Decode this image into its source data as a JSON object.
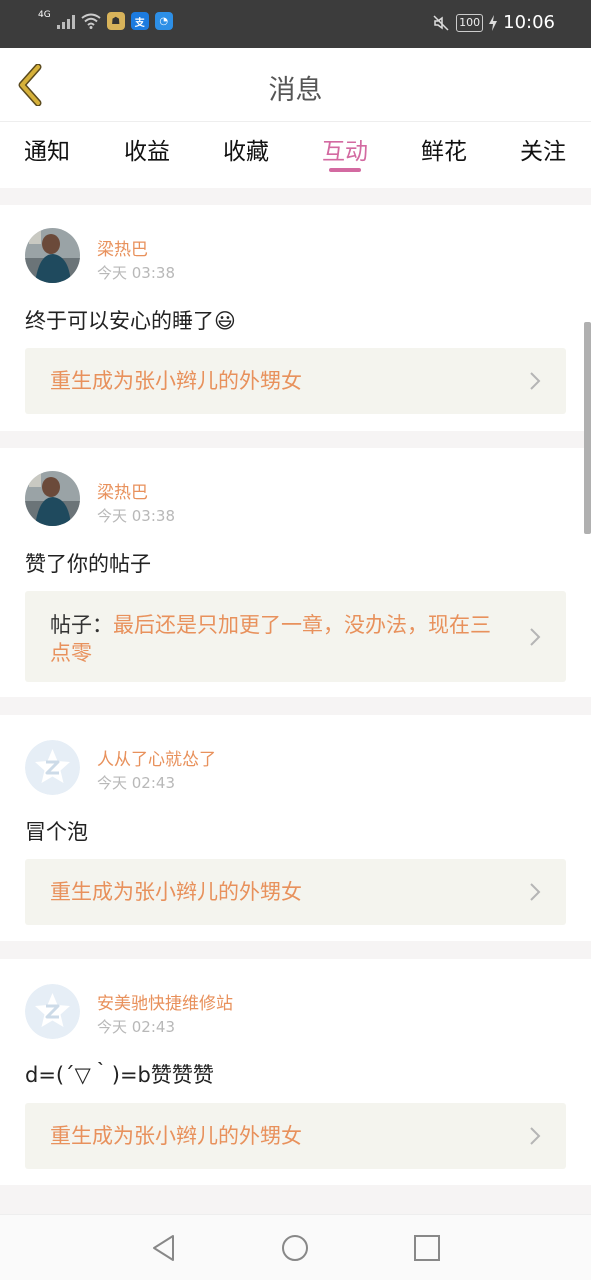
{
  "status_bar": {
    "network": "4G",
    "time": "10:06",
    "battery": "100",
    "icons": [
      "signal-icon",
      "wifi-icon",
      "app-notification-icon",
      "alipay-icon",
      "browser-icon",
      "mute-icon",
      "battery-icon",
      "charging-icon"
    ]
  },
  "header": {
    "title": "消息",
    "back_icon": "chevron-left-icon"
  },
  "tabs": [
    {
      "label": "通知",
      "active": false
    },
    {
      "label": "收益",
      "active": false
    },
    {
      "label": "收藏",
      "active": false
    },
    {
      "label": "互动",
      "active": true
    },
    {
      "label": "鲜花",
      "active": false
    },
    {
      "label": "关注",
      "active": false
    }
  ],
  "messages": [
    {
      "user": "梁热巴",
      "time": "今天 03:38",
      "content": "终于可以安心的睡了",
      "emoji": "😃",
      "link": {
        "prefix": "",
        "text": "重生成为张小辫儿的外甥女"
      }
    },
    {
      "user": "梁热巴",
      "time": "今天 03:38",
      "content": "赞了你的帖子",
      "link": {
        "prefix": "帖子：",
        "text": "最后还是只加更了一章，没办法，现在三点零"
      }
    },
    {
      "user": "人从了心就怂了",
      "time": "今天 02:43",
      "content": "冒个泡",
      "link": {
        "prefix": "",
        "text": "重生成为张小辫儿的外甥女"
      }
    },
    {
      "user": "安美驰快捷维修站",
      "time": "今天 02:43",
      "content": "d=(´▽｀)=b赞赞赞",
      "link": {
        "prefix": "",
        "text": "重生成为张小辫儿的外甥女"
      }
    }
  ],
  "colors": {
    "accent": "#d36aa1",
    "orange": "#e8915c",
    "status_bar": "#3c3c3c",
    "link_bg": "#f4f4ee",
    "back_icon": "#d6b13a"
  },
  "nav_bar": {
    "icons": [
      "back-triangle-icon",
      "home-circle-icon",
      "recents-square-icon"
    ]
  }
}
